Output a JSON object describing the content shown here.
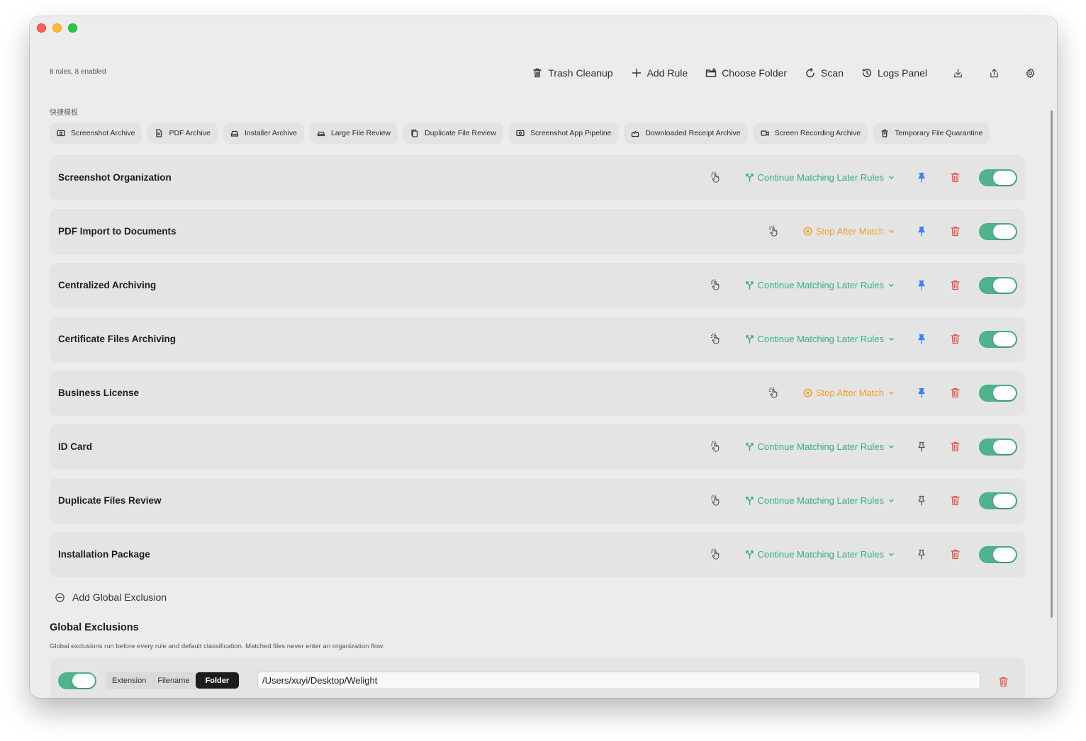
{
  "window": {
    "summary": "8 rules, 8 enabled"
  },
  "toolbar": {
    "trash_cleanup": "Trash Cleanup",
    "add_rule": "Add Rule",
    "choose_folder": "Choose Folder",
    "scan": "Scan",
    "logs_panel": "Logs Panel",
    "icons": [
      "import-icon",
      "export-icon",
      "gear-icon"
    ]
  },
  "quick_templates": {
    "label": "快捷模板",
    "items": [
      {
        "label": "Screenshot Archive",
        "icon": "screenshot-icon"
      },
      {
        "label": "PDF Archive",
        "icon": "document-icon"
      },
      {
        "label": "Installer Archive",
        "icon": "drive-icon"
      },
      {
        "label": "Large File Review",
        "icon": "disk-icon"
      },
      {
        "label": "Duplicate File Review",
        "icon": "duplicate-icon"
      },
      {
        "label": "Screenshot App Pipeline",
        "icon": "screenshot-icon"
      },
      {
        "label": "Downloaded Receipt Archive",
        "icon": "receipt-icon"
      },
      {
        "label": "Screen Recording Archive",
        "icon": "video-icon"
      },
      {
        "label": "Temporary File Quarantine",
        "icon": "bin-icon"
      }
    ]
  },
  "rules": [
    {
      "name": "Screenshot Organization",
      "mode": "continue",
      "mode_label": "Continue Matching Later Rules",
      "pinned": true,
      "enabled": true
    },
    {
      "name": "PDF Import to Documents",
      "mode": "stop",
      "mode_label": "Stop After Match",
      "pinned": true,
      "enabled": true
    },
    {
      "name": "Centralized Archiving",
      "mode": "continue",
      "mode_label": "Continue Matching Later Rules",
      "pinned": true,
      "enabled": true
    },
    {
      "name": "Certificate Files Archiving",
      "mode": "continue",
      "mode_label": "Continue Matching Later Rules",
      "pinned": true,
      "enabled": true
    },
    {
      "name": "Business License",
      "mode": "stop",
      "mode_label": "Stop After Match",
      "pinned": true,
      "enabled": true
    },
    {
      "name": "ID Card",
      "mode": "continue",
      "mode_label": "Continue Matching Later Rules",
      "pinned": false,
      "enabled": true
    },
    {
      "name": "Duplicate Files Review",
      "mode": "continue",
      "mode_label": "Continue Matching Later Rules",
      "pinned": false,
      "enabled": true
    },
    {
      "name": "Installation Package",
      "mode": "continue",
      "mode_label": "Continue Matching Later Rules",
      "pinned": false,
      "enabled": true
    }
  ],
  "colors": {
    "continue": "#34b07f",
    "stop": "#f0a02a",
    "pin_active": "#3b82f6",
    "pin_inactive": "#555555",
    "delete": "#e05247",
    "toggle_on": "#4fb38d"
  },
  "add_global_exclusion": "Add Global Exclusion",
  "global_exclusions": {
    "title": "Global Exclusions",
    "description": "Global exclusions run before every rule and default classification. Matched files never enter an organization flow.",
    "items": [
      {
        "enabled": true,
        "types": [
          "Extension",
          "Filename",
          "Folder"
        ],
        "selected_type": "Folder",
        "value": "/Users/xuyi/Desktop/Welight"
      }
    ]
  }
}
